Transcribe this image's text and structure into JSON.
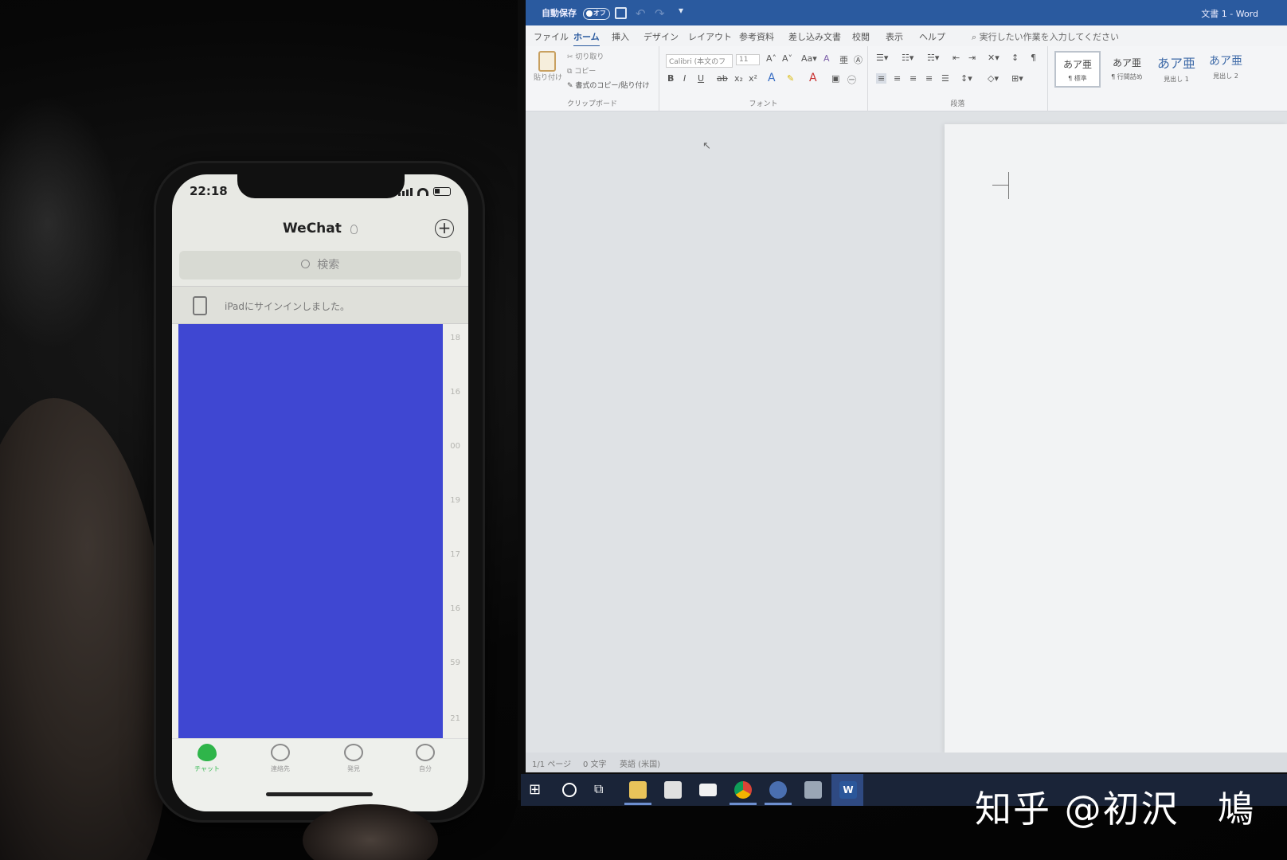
{
  "phone": {
    "time": "22:18",
    "title": "WeChat",
    "search_placeholder": "検索",
    "notice": "iPadにサインインしました。",
    "side_numbers": [
      "18",
      "16",
      "00",
      "19",
      "17",
      "16",
      "59",
      "21"
    ],
    "tabs": [
      {
        "label": "チャット",
        "icon": "chat-icon"
      },
      {
        "label": "連絡先",
        "icon": "contacts-icon"
      },
      {
        "label": "発見",
        "icon": "discover-icon"
      },
      {
        "label": "自分",
        "icon": "me-icon"
      }
    ],
    "block_color": "#3f47d2"
  },
  "word": {
    "autosave_label": "自動保存",
    "autosave_state": "オフ",
    "document_title": "文書 1 - Word",
    "menu": [
      "ファイル",
      "ホーム",
      "挿入",
      "デザイン",
      "レイアウト",
      "参考資料",
      "差し込み文書",
      "校閲",
      "表示",
      "ヘルプ"
    ],
    "active_menu": "ホーム",
    "tell_me": "実行したい作業を入力してください",
    "clipboard": {
      "paste": "貼り付け",
      "cut": "切り取り",
      "copy": "コピー",
      "format_painter": "書式のコピー/貼り付け",
      "label": "クリップボード"
    },
    "font": {
      "name": "Calibri (本文のフ",
      "size": "11",
      "label": "フォント"
    },
    "paragraph": {
      "label": "段落"
    },
    "styles": [
      {
        "sample": "あア亜",
        "name": "¶ 標準"
      },
      {
        "sample": "あア亜",
        "name": "¶ 行間詰め"
      },
      {
        "sample": "あア亜",
        "name": "見出し 1"
      },
      {
        "sample": "あア亜",
        "name": "見出し 2"
      }
    ],
    "status": {
      "page": "1/1 ページ",
      "words": "0 文字",
      "language": "英語 (米国)"
    },
    "accent": "#2a5a9f"
  },
  "watermark": "知乎 @初沢　鳩"
}
